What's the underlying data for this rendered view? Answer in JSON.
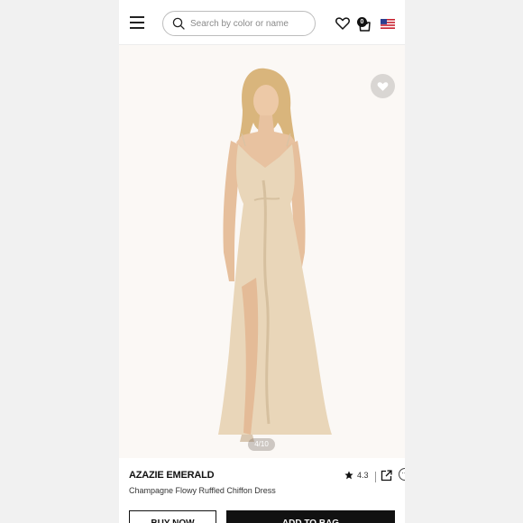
{
  "header": {
    "search_placeholder": "Search by color or name",
    "bag_count": "0"
  },
  "gallery": {
    "counter": "4/10"
  },
  "product": {
    "brand": "AZAZIE EMERALD",
    "name": "Champagne Flowy Ruffled Chiffon Dress",
    "rating": "4.3"
  },
  "actions": {
    "buy_now": "BUY NOW",
    "add_to_bag": "ADD TO BAG"
  },
  "colors": {
    "dress": "#e9d6b9",
    "button_dark": "#111111"
  }
}
